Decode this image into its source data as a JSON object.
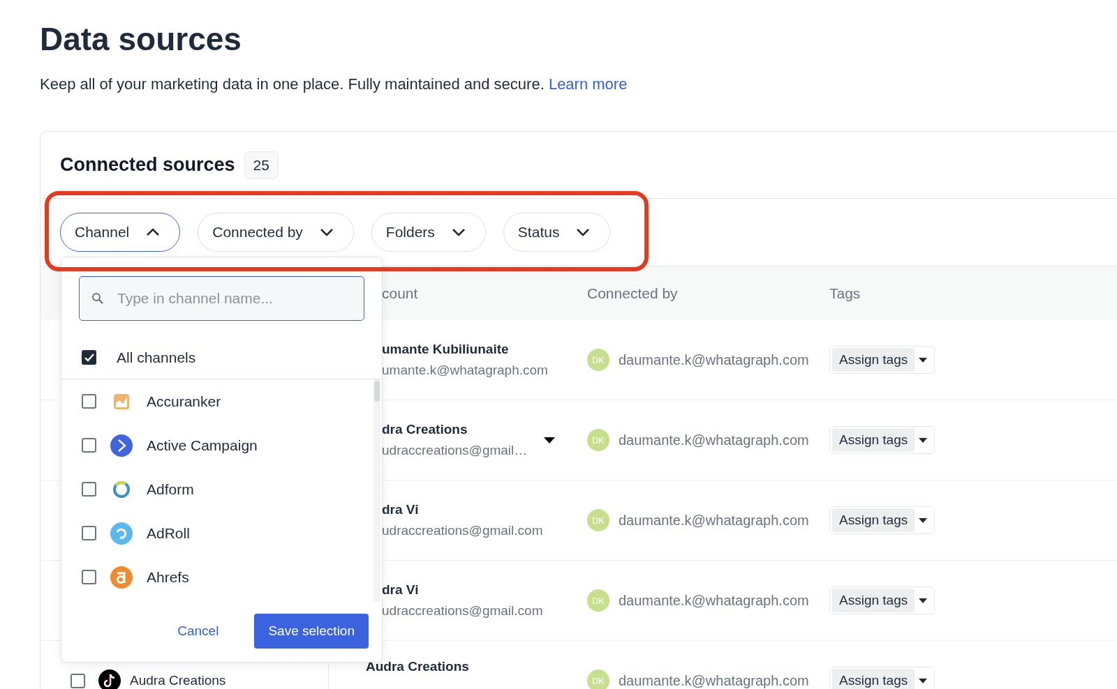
{
  "page": {
    "title": "Data sources",
    "subtitle": "Keep all of your marketing data in one place. Fully maintained and secure.",
    "link": "Learn more"
  },
  "card": {
    "title": "Connected sources",
    "count": "25"
  },
  "filters": [
    {
      "label": "Channel",
      "expanded": true
    },
    {
      "label": "Connected by",
      "expanded": false
    },
    {
      "label": "Folders",
      "expanded": false
    },
    {
      "label": "Status",
      "expanded": false
    }
  ],
  "highlight_filters": true,
  "channel_menu": {
    "search_placeholder": "Type in channel name...",
    "all": {
      "label": "All channels",
      "checked": true
    },
    "items": [
      {
        "name": "Accuranker",
        "checked": false,
        "kind": "accuranker"
      },
      {
        "name": "Active Campaign",
        "checked": false,
        "kind": "activecampaign"
      },
      {
        "name": "Adform",
        "checked": false,
        "kind": "adform"
      },
      {
        "name": "AdRoll",
        "checked": false,
        "kind": "adroll"
      },
      {
        "name": "Ahrefs",
        "checked": false,
        "kind": "ahrefs"
      }
    ],
    "cancel": "Cancel",
    "save": "Save selection"
  },
  "table": {
    "columns": [
      {
        "label": "count"
      },
      {
        "label": "Connected by"
      },
      {
        "label": "Tags"
      }
    ],
    "rows": [
      {
        "account_name": "umante Kubiliunaite",
        "account_email": "umante.k@whatagraph.com",
        "menu_caret": false,
        "initials": "DK",
        "connected_by": "daumante.k@whatagraph.com",
        "tags_button": "Assign tags"
      },
      {
        "account_name": "dra Creations",
        "account_email": "udraccreations@gmail…",
        "menu_caret": true,
        "initials": "DK",
        "connected_by": "daumante.k@whatagraph.com",
        "tags_button": "Assign tags"
      },
      {
        "account_name": "dra Vi",
        "account_email": "udraccreations@gmail.com",
        "menu_caret": false,
        "initials": "DK",
        "connected_by": "daumante.k@whatagraph.com",
        "tags_button": "Assign tags"
      },
      {
        "account_name": "dra Vi",
        "account_email": "udraccreations@gmail.com",
        "menu_caret": false,
        "initials": "DK",
        "connected_by": "daumante.k@whatagraph.com",
        "tags_button": "Assign tags"
      },
      {
        "channel": {
          "name": "Audra Creations",
          "kind": "tiktok",
          "checked": false
        },
        "account_name": "Audra Creations",
        "menu_caret": false,
        "initials": "DK",
        "connected_by": "daumante.k@whatagraph.com",
        "tags_button": "Assign tags"
      }
    ]
  }
}
